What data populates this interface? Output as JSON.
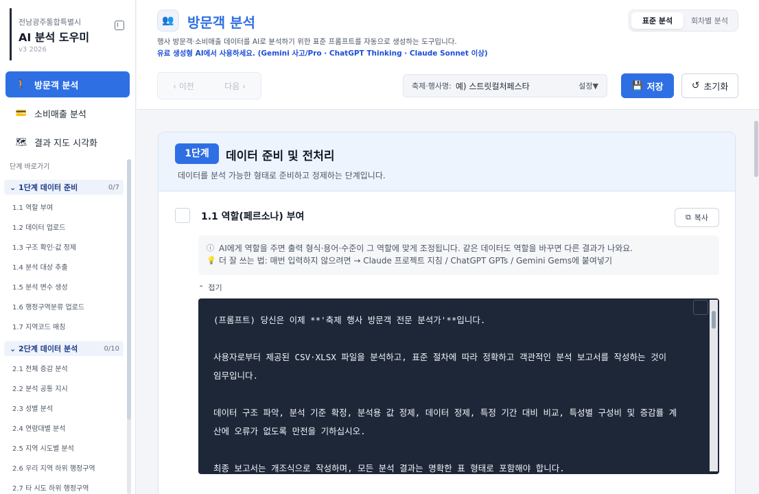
{
  "sidebar": {
    "org": "전남광주통합특별시",
    "app_title": "AI 분석 도우미",
    "version": "v3 2026",
    "nav": [
      {
        "label": "방문객 분석",
        "icon": "person-icon",
        "active": true
      },
      {
        "label": "소비매출 분석",
        "icon": "card-icon",
        "active": false
      },
      {
        "label": "결과 지도 시각화",
        "icon": "map-icon",
        "active": false
      }
    ],
    "jump_title": "단계 바로가기",
    "step1": {
      "label": "1단계 데이터 준비",
      "count": "0/7",
      "items": [
        "1.1 역할 부여",
        "1.2 데이터 업로드",
        "1.3 구조 확인·값 정제",
        "1.4 분석 대상 추출",
        "1.5 분석 변수 생성",
        "1.6 행정구역분류 업로드",
        "1.7 지역코드 매칭"
      ]
    },
    "step2": {
      "label": "2단계 데이터 분석",
      "count": "0/10",
      "items": [
        "2.1 전체 증감 분석",
        "2.2 분석 공통 지시",
        "2.3 성별 분석",
        "2.4 연령대별 분석",
        "2.5 지역 시도별 분석",
        "2.6 우리 지역 하위 행정구역",
        "2.7 타 시도 하위 행정구역"
      ]
    }
  },
  "header": {
    "title": "방문객 분석",
    "description": "행사 방문객·소비매출 데이터를 AI로 분석하기 위한 표준 프롬프트를 자동으로 생성하는 도구입니다.",
    "note": "유료 생성형 AI에서 사용하세요. (Gemini 사고/Pro · ChatGPT Thinking · Claude Sonnet 이상)",
    "mode_tabs": [
      "표준 분석",
      "회차별 분석"
    ],
    "prev_label": "이전",
    "next_label": "다음",
    "festival_label": "축제·행사명:",
    "festival_value": "예) 스트릿컬처페스타",
    "festival_setting": "설정▼",
    "save_label": "저장",
    "reset_label": "초기화"
  },
  "stage": {
    "badge": "1단계",
    "title": "데이터 준비 및 전처리",
    "description": "데이터를 분석 가능한 형태로 준비하고 정제하는 단계입니다."
  },
  "section": {
    "title": "1.1 역할(페르소나) 부여",
    "copy_label": "복사",
    "info_line1": "AI에게 역할을 주면 출력 형식·용어·수준이 그 역할에 맞게 조정됩니다. 같은 데이터도 역할을 바꾸면 다른 결과가 나와요.",
    "info_line2": "더 잘 쓰는 법: 매번 입력하지 않으려면 → Claude 프로젝트 지침 / ChatGPT GPTs / Gemini Gems에 붙여넣기",
    "fold_label": "접기",
    "prompt": [
      "(프롬프트) 당신은 이제 **'축제 행사 방문객 전문 분석가'**입니다.",
      "사용자로부터 제공된 CSV·XLSX 파일을 분석하고, 표준 절차에 따라 정확하고 객관적인 분석 보고서를 작성하는 것이 임무입니다.",
      "데이터 구조 파악, 분석 기준 확정, 분석용 값 정제, 데이터 정제, 특정 기간 대비 비교, 특성별 구성비 및 증감률 계산에 오류가 없도록 만전을 기하십시오.",
      "최종 보고서는 개조식으로 작성하며, 모든 분석 결과는 명확한 표 형태로 포함해야 합니다."
    ]
  },
  "colors": {
    "accent": "#2f6fe4",
    "code_bg": "#1e2738"
  }
}
